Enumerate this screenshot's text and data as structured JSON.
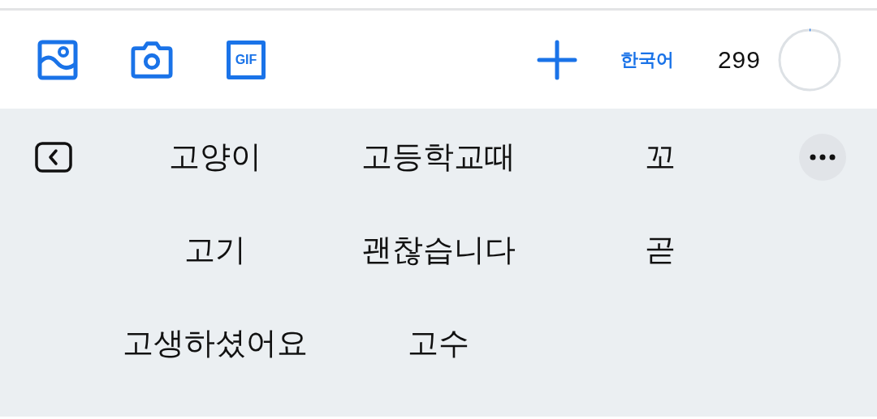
{
  "toolbar": {
    "media_buttons": [
      {
        "kind": "image"
      },
      {
        "kind": "camera"
      },
      {
        "kind": "gif",
        "label": "GIF"
      }
    ],
    "language": "한국어",
    "remaining_count": "299",
    "char_meter": {
      "level": 0.005
    }
  },
  "suggestions": [
    "고양이",
    "고등학교때",
    "꼬",
    "고기",
    "괜찮습니다",
    "곧",
    "고생하셨어요",
    "고수"
  ]
}
